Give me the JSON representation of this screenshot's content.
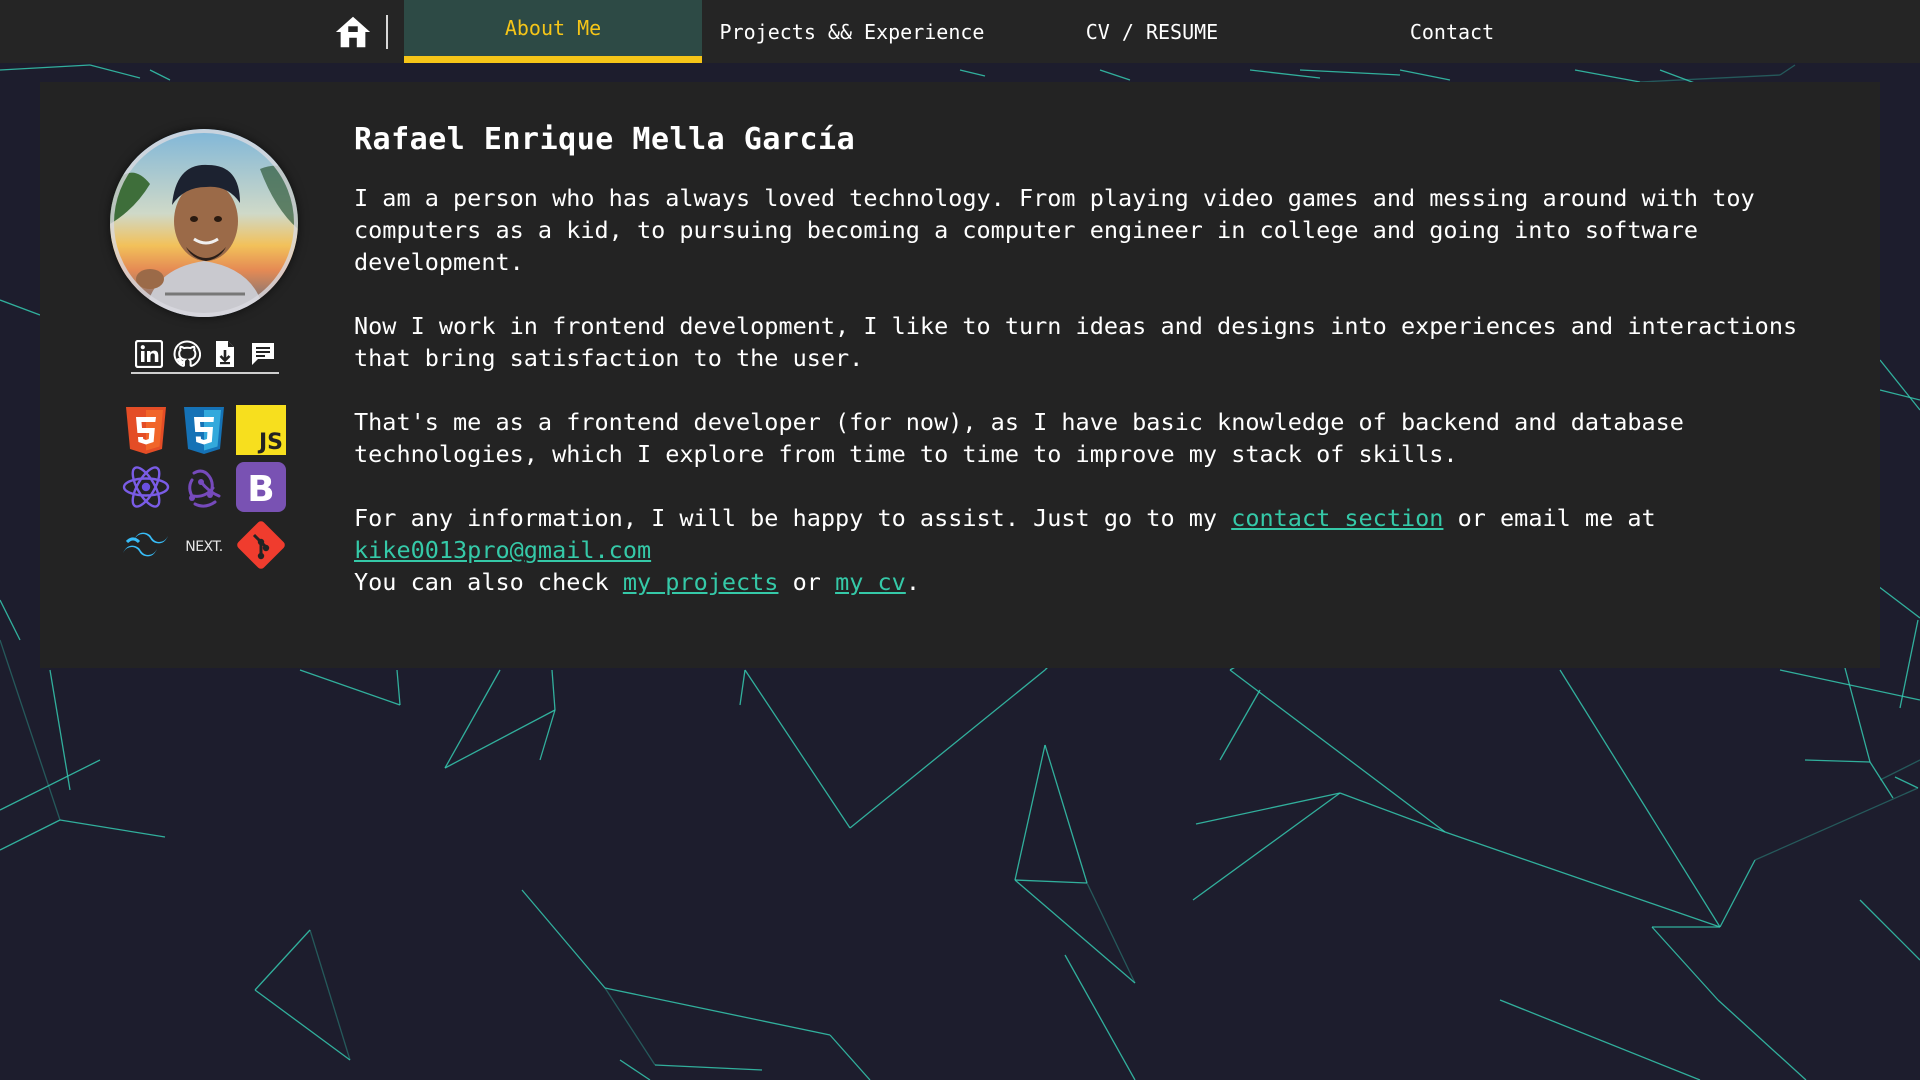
{
  "nav": {
    "home_icon": "home-icon",
    "items": [
      {
        "label": "About Me",
        "active": true
      },
      {
        "label": "Projects && Experience",
        "active": false
      },
      {
        "label": "CV / RESUME",
        "active": false
      },
      {
        "label": "Contact",
        "active": false
      }
    ]
  },
  "profile": {
    "name": "Rafael Enrique Mella García",
    "socials": [
      "linkedin-icon",
      "github-icon",
      "download-cv-icon",
      "message-icon"
    ],
    "tech_icons": [
      "html5-icon",
      "css3-icon",
      "javascript-icon",
      "react-icon",
      "redux-icon",
      "bootstrap-icon",
      "tailwind-icon",
      "nextjs-icon",
      "git-icon"
    ],
    "tech_text": {
      "js": "JS",
      "bootstrap": "B",
      "next": "NEXT."
    }
  },
  "about": {
    "p1": "I am a person who has always loved technology. From playing video games and messing around with toy computers as a kid, to pursuing becoming a computer engineer in college and going into software development.",
    "p2": "Now I work in frontend development, I like to turn ideas and designs into experiences and interactions that bring satisfaction to the user.",
    "p3": "That's me as a frontend developer (for now), as I have basic knowledge of backend and database technologies, which I explore from time to time to improve my stack of skills.",
    "p4_before": "For any information, I will be happy to assist. Just go to my ",
    "contact_link": "contact section",
    "p4_middle": " or email me at ",
    "email": "kike0013pro@gmail.com",
    "p5_before": "You can also check ",
    "projects_link": "my projects",
    "p5_middle": " or ",
    "cv_link": "my cv",
    "p5_after": "."
  },
  "colors": {
    "background": "#1d1d2d",
    "navbar": "#252525",
    "active_tab": "#2d4a45",
    "accent": "#f5c518",
    "link": "#35c9a8",
    "card": "#232323",
    "network_lines": "#35c9b0"
  }
}
